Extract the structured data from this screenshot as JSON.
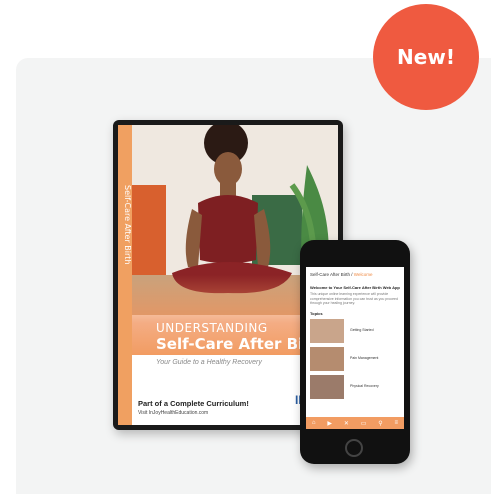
{
  "badge": {
    "label": "New!"
  },
  "dvd": {
    "spine_text": "Self-Care After Birth",
    "title_small": "Understanding",
    "title_big": "Self-Care After Birth",
    "subtitle": "Your Guide to a Healthy Recovery",
    "curriculum": "Part of a Complete Curriculum!",
    "visit": "Visit InJoyHealthEducation.com",
    "logo": "INJ"
  },
  "app": {
    "header": "Self-Care After Birth",
    "header_accent": "Welcome",
    "welcome": "Welcome to Your Self-Care After Birth Web App",
    "blurb": "This unique online learning experience will provide comprehensive information you can trust as you proceed through your healing journey.",
    "topics_heading": "Topics",
    "topics": [
      "Getting Started",
      "Pain Management",
      "Physical Recovery"
    ]
  }
}
